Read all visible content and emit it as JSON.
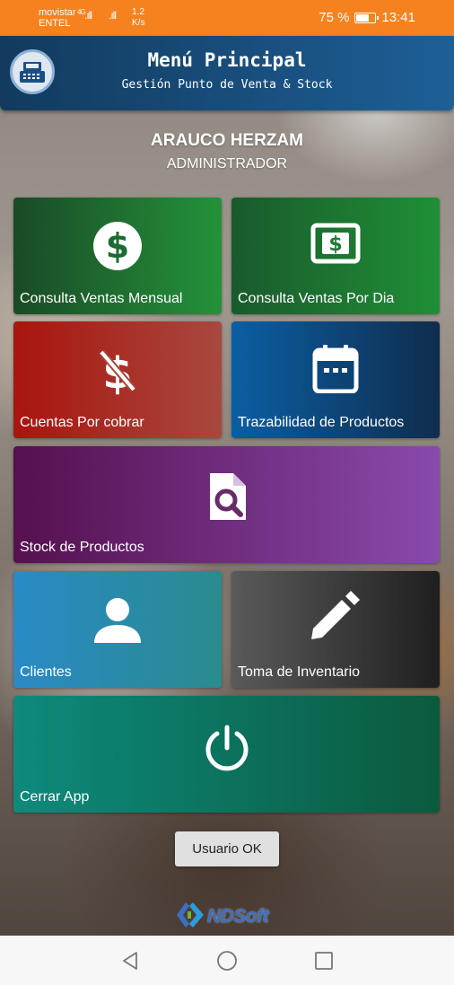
{
  "statusbar": {
    "carrier_name": "movistar",
    "carrier_net": "ENTEL",
    "network_type": "4G",
    "signal_1": ".ıll",
    "signal_2": ".ıll",
    "speed_value": "1.2",
    "speed_unit": "K/s",
    "battery_text": "75 %",
    "battery_level": 0.75,
    "time": "13:41"
  },
  "header": {
    "title": "Menú Principal",
    "subtitle": "Gestión Punto de Venta & Stock",
    "logo_icon": "cash-register-icon"
  },
  "user": {
    "name": "ARAUCO HERZAM",
    "role": "ADMINISTRADOR"
  },
  "tiles": [
    {
      "label": "Consulta Ventas Mensual",
      "icon": "dollar-circle-icon"
    },
    {
      "label": "Consulta Ventas Por Dia",
      "icon": "dollar-bill-icon"
    },
    {
      "label": "Cuentas Por cobrar",
      "icon": "dollar-off-icon"
    },
    {
      "label": "Trazabilidad de Productos",
      "icon": "calendar-icon"
    },
    {
      "label": "Stock de Productos",
      "icon": "file-search-icon"
    },
    {
      "label": "Clientes",
      "icon": "person-icon"
    },
    {
      "label": "Toma de Inventario",
      "icon": "pencil-icon"
    },
    {
      "label": "Cerrar App",
      "icon": "power-icon"
    }
  ],
  "ok_button": "Usuario OK",
  "brand": {
    "text": "NDSoft",
    "icon": "nd-logo-icon",
    "color": "#3b6fc2"
  },
  "colors": {
    "statusbar": "#f6821f",
    "header": "#1d5f96"
  },
  "navbar": {
    "back_icon": "back-triangle-icon",
    "home_icon": "home-circle-icon",
    "recents_icon": "recents-square-icon"
  }
}
